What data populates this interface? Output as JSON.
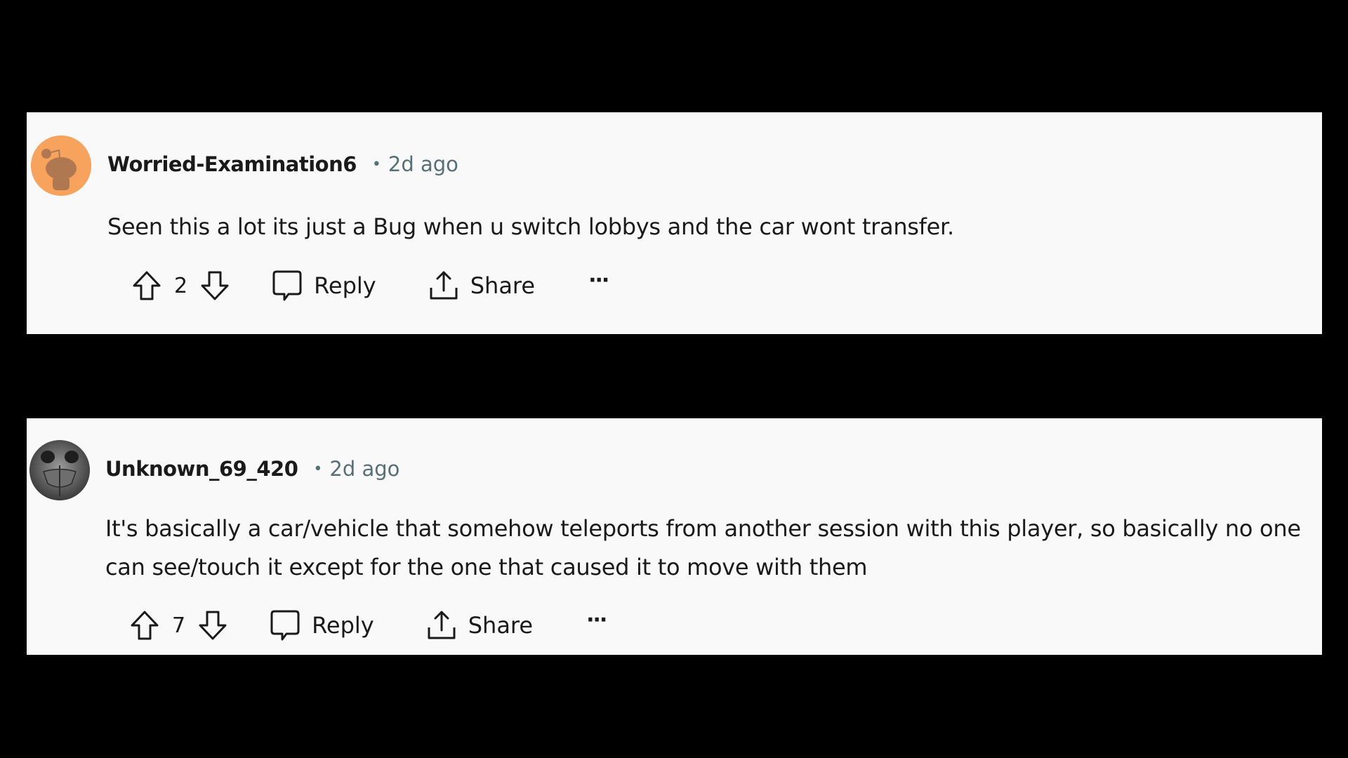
{
  "comments": [
    {
      "username": "Worried-Examination6",
      "separator": "•",
      "time": "2d ago",
      "body": "Seen this a lot its just a Bug when u switch lobbys and the car wont transfer.",
      "votes": "2",
      "avatar_icon": "snoo-avatar-icon",
      "avatar_color": "#f7a35e",
      "reply_label": "Reply",
      "share_label": "Share",
      "more_label": "···"
    },
    {
      "username": "Unknown_69_420",
      "separator": "•",
      "time": "2d ago",
      "body": "It's basically a car/vehicle that somehow teleports from another session with this player, so basically no one can see/touch it except for the one that caused it to move with them",
      "votes": "7",
      "avatar_icon": "user-photo-avatar-icon",
      "avatar_color": "#5a5a5a",
      "reply_label": "Reply",
      "share_label": "Share",
      "more_label": "···"
    }
  ],
  "colors": {
    "background": "#000000",
    "panel": "#f9f9f9",
    "text": "#1a1a1b",
    "meta": "#576f76"
  }
}
